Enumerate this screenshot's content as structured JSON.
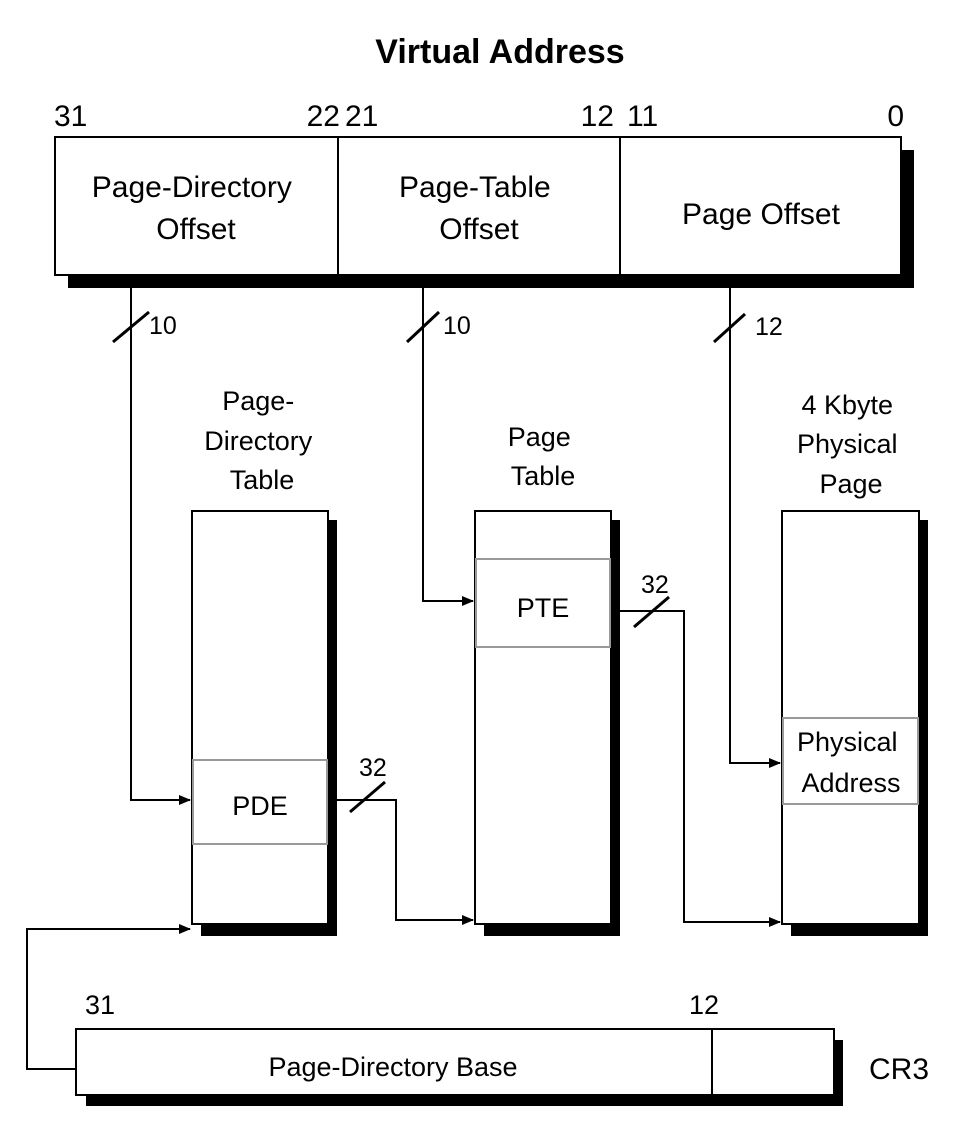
{
  "title": "Virtual Address",
  "virtual_address": {
    "bits": {
      "pd_high": "31",
      "pd_low": "22",
      "pt_high": "21",
      "pt_low": "12",
      "off_high": "11",
      "off_low": "0"
    },
    "fields": {
      "pd_line1": "Page-Directory",
      "pd_line2": "Offset",
      "pt_line1": "Page-Table",
      "pt_line2": "Offset",
      "offset": "Page Offset"
    }
  },
  "bus_widths": {
    "pd_index": "10",
    "pt_index": "10",
    "offset": "12",
    "pde_out": "32",
    "pte_out": "32"
  },
  "tables": {
    "page_directory": {
      "line1": "Page-",
      "line2": "Directory",
      "line3": "Table",
      "entry": "PDE"
    },
    "page_table": {
      "line1": "Page",
      "line2": "Table",
      "entry": "PTE"
    },
    "physical_page": {
      "line1": "4 Kbyte",
      "line2": "Physical",
      "line3": "Page",
      "entry_line1": "Physical",
      "entry_line2": "Address"
    }
  },
  "cr3": {
    "bit_high": "31",
    "bit_low": "12",
    "field": "Page-Directory Base",
    "name": "CR3"
  }
}
